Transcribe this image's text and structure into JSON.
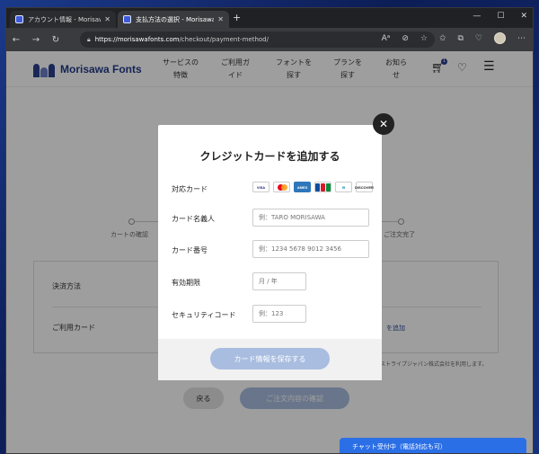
{
  "browser": {
    "tabs": [
      {
        "title": "アカウント情報 - Morisawa ID"
      },
      {
        "title": "支払方法の選択 - Morisawa Fonts"
      }
    ],
    "url_host": "https://morisawafonts.com",
    "url_path": "/checkout/payment-method/"
  },
  "site": {
    "logo_text": "Morisawa Fonts",
    "nav": [
      {
        "line1": "サービスの",
        "line2": "特徴"
      },
      {
        "line1": "ご利用ガ",
        "line2": "イド"
      },
      {
        "line1": "フォントを",
        "line2": "探す"
      },
      {
        "line1": "プランを",
        "line2": "探す"
      },
      {
        "line1": "お知ら",
        "line2": "せ"
      }
    ],
    "cart_count": "1"
  },
  "checkout": {
    "step_left": "カートの確認",
    "step_right": "ご注文完了",
    "payment_method_label": "決済方法",
    "card_label": "ご利用カード",
    "add_card_link": "を追加",
    "stripe_note": "ストライプジャパン株式会社を利用します。",
    "back_label": "戻る",
    "confirm_label": "ご注文内容の確認"
  },
  "modal": {
    "title": "クレジットカードを追加する",
    "supported_cards_label": "対応カード",
    "brands": [
      "VISA",
      "MC",
      "AMEX",
      "JCB",
      "Diners",
      "DISCOVER"
    ],
    "cardholder_label": "カード名義人",
    "cardholder_placeholder": "例：TARO MORISAWA",
    "number_label": "カード番号",
    "number_placeholder": "例：1234 5678 9012 3456",
    "expiry_label": "有効期限",
    "expiry_placeholder": "月 / 年",
    "cvc_label": "セキュリティコード",
    "cvc_placeholder": "例：123",
    "save_label": "カード情報を保存する"
  },
  "chat": {
    "label": "チャット受付中（電話対応も可）"
  },
  "colors": {
    "brand_navy": "#2b3f8f",
    "button_disabled": "#a9bde0",
    "chat_blue": "#2b6fe6"
  }
}
